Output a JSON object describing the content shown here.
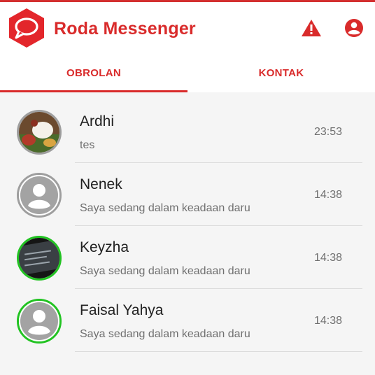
{
  "app": {
    "title": "Roda Messenger"
  },
  "colors": {
    "accent": "#d92b2b",
    "online_ring": "#22c322",
    "avatar_ring": "#9e9e9e"
  },
  "icons": {
    "logo": "chat-bubble-hexagon",
    "warning": "warning-icon",
    "account": "account-circle-icon"
  },
  "tabs": [
    {
      "label": "OBROLAN",
      "active": true
    },
    {
      "label": "KONTAK",
      "active": false
    }
  ],
  "chats": [
    {
      "name": "Ardhi",
      "message": "tes",
      "time": "23:53",
      "avatar": "food-photo",
      "online": false
    },
    {
      "name": "Nenek",
      "message": "Saya sedang dalam keadaan daru",
      "time": "14:38",
      "avatar": "default",
      "online": false
    },
    {
      "name": "Keyzha",
      "message": "Saya sedang dalam keadaan daru",
      "time": "14:38",
      "avatar": "dark-photo",
      "online": true
    },
    {
      "name": "Faisal Yahya",
      "message": "Saya sedang dalam keadaan daru",
      "time": "14:38",
      "avatar": "default",
      "online": true
    }
  ]
}
